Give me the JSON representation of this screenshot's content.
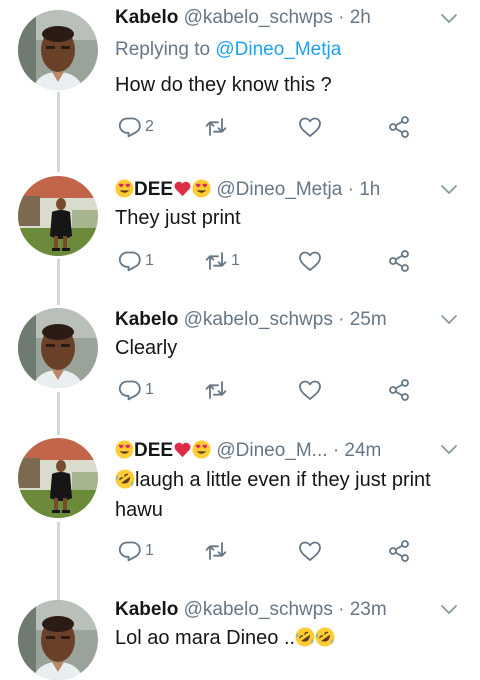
{
  "colors": {
    "text": "#14171a",
    "secondary": "#657786",
    "link": "#1da1f2",
    "line": "#cfd9de",
    "heart": "#e0245e"
  },
  "tweets": [
    {
      "author": "Kabelo",
      "handle": "@kabelo_schwps",
      "dot": "·",
      "time": "2h",
      "replying_prefix": "Replying to",
      "replying_to": "@Dineo_Metja",
      "text": "How do they know this ?",
      "reply_count": "2",
      "retweet_count": "",
      "avatar": "man-avatar"
    },
    {
      "author": "DEE",
      "author_emoji": [
        "heart-eyes-emoji",
        "red-heart-emoji",
        "heart-eyes-emoji"
      ],
      "handle": "@Dineo_Metja",
      "dot": "·",
      "time": "1h",
      "text": "They just print",
      "reply_count": "1",
      "retweet_count": "1",
      "avatar": "woman-avatar"
    },
    {
      "author": "Kabelo",
      "handle": "@kabelo_schwps",
      "dot": "·",
      "time": "25m",
      "text": "Clearly",
      "reply_count": "1",
      "retweet_count": "",
      "avatar": "man-avatar"
    },
    {
      "author": "DEE",
      "author_emoji": [
        "heart-eyes-emoji",
        "red-heart-emoji",
        "heart-eyes-emoji"
      ],
      "handle": "@Dineo_M...",
      "dot": "·",
      "time": "24m",
      "text_line1": "laugh a little even if they just print",
      "text_line2": "hawu",
      "text_emoji": "rolling-laughing-emoji",
      "reply_count": "1",
      "retweet_count": "",
      "avatar": "woman-avatar"
    },
    {
      "author": "Kabelo",
      "handle": "@kabelo_schwps",
      "dot": "·",
      "time": "23m",
      "text": "Lol ao mara Dineo ..",
      "text_emoji": [
        "rolling-laughing-emoji",
        "rolling-laughing-emoji"
      ],
      "avatar": "man-avatar"
    }
  ]
}
